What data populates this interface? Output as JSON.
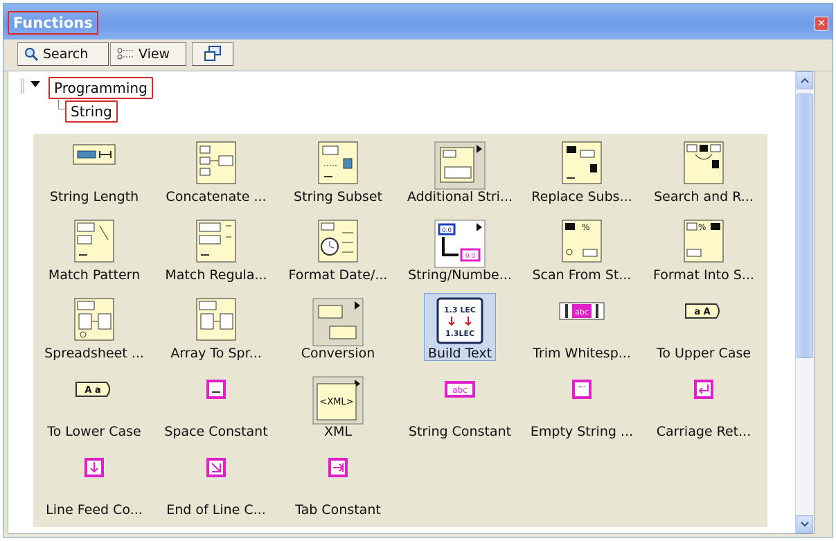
{
  "window": {
    "title": "Functions"
  },
  "toolbar": {
    "search_label": "Search",
    "view_label": "View"
  },
  "tree": {
    "root": "Programming",
    "child": "String"
  },
  "palette": {
    "items": [
      {
        "label": "String Length",
        "icon": "string-length-icon"
      },
      {
        "label": "Concatenate ...",
        "icon": "concatenate-icon"
      },
      {
        "label": "String Subset",
        "icon": "string-subset-icon"
      },
      {
        "label": "Additional Stri...",
        "icon": "additional-string-icon"
      },
      {
        "label": "Replace Subs...",
        "icon": "replace-substring-icon"
      },
      {
        "label": "Search and R...",
        "icon": "search-replace-icon"
      },
      {
        "label": "Match Pattern",
        "icon": "match-pattern-icon"
      },
      {
        "label": "Match Regula...",
        "icon": "match-regex-icon"
      },
      {
        "label": "Format Date/...",
        "icon": "format-date-icon"
      },
      {
        "label": "String/Numbe...",
        "icon": "string-number-icon"
      },
      {
        "label": "Scan From St...",
        "icon": "scan-string-icon"
      },
      {
        "label": "Format Into S...",
        "icon": "format-into-string-icon"
      },
      {
        "label": "Spreadsheet ...",
        "icon": "spreadsheet-icon"
      },
      {
        "label": "Array To Spr...",
        "icon": "array-to-spreadsheet-icon"
      },
      {
        "label": "Conversion",
        "icon": "conversion-icon"
      },
      {
        "label": "Build Text",
        "icon": "build-text-icon"
      },
      {
        "label": "Trim Whitesp...",
        "icon": "trim-whitespace-icon"
      },
      {
        "label": "To Upper Case",
        "icon": "upper-case-icon"
      },
      {
        "label": "To Lower Case",
        "icon": "lower-case-icon"
      },
      {
        "label": "Space Constant",
        "icon": "space-constant-icon"
      },
      {
        "label": "XML",
        "icon": "xml-icon"
      },
      {
        "label": "String Constant",
        "icon": "string-constant-icon"
      },
      {
        "label": "Empty String ...",
        "icon": "empty-string-icon"
      },
      {
        "label": "Carriage Ret...",
        "icon": "carriage-return-icon"
      },
      {
        "label": "Line Feed Co...",
        "icon": "line-feed-icon"
      },
      {
        "label": "End of Line C...",
        "icon": "end-of-line-icon"
      },
      {
        "label": "Tab Constant",
        "icon": "tab-constant-icon"
      }
    ],
    "icon_texts": {
      "abc": "abc",
      "xml": "<XML>",
      "upper": "a A",
      "lower": "A a",
      "build_top": "1.3 LEC",
      "build_bottom": "1.3LEC",
      "num": "0.0"
    }
  },
  "colors": {
    "accent": "#d52b2b",
    "titlebar": "#6f9ce8",
    "palette_bg": "#e8e5d2",
    "string_pink": "#e020c8"
  }
}
